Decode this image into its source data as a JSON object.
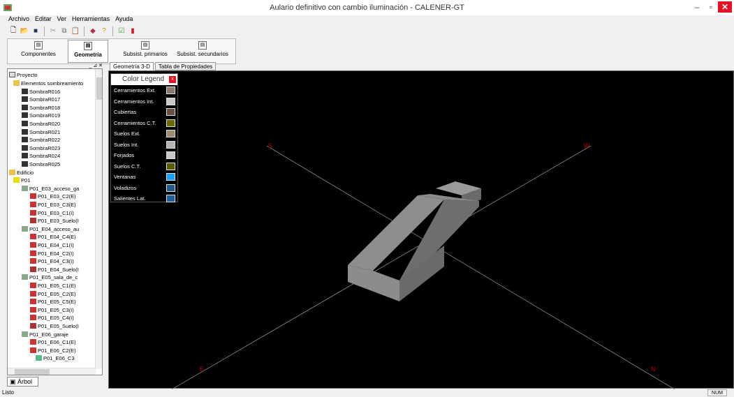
{
  "window": {
    "title": "Aulario definitivo con cambio iluminación - CALENER-GT"
  },
  "menu": [
    "Archivo",
    "Editar",
    "Ver",
    "Herramientas",
    "Ayuda"
  ],
  "ribbon_tabs": [
    {
      "label": "Componentes"
    },
    {
      "label": "Geometría"
    },
    {
      "label": "Subsist. primarios"
    },
    {
      "label": "Subsist. secundarios"
    }
  ],
  "tree": {
    "root": "Proyecto",
    "items": [
      "Elementos sombreamiento",
      "SombraR016",
      "SombraR017",
      "SombraR018",
      "SombraR019",
      "SombraR020",
      "SombraR021",
      "SombraR022",
      "SombraR023",
      "SombraR024",
      "SombraR025",
      "Edificio",
      "P01",
      "P01_E03_acceso_ga",
      "P01_E03_C2(E)",
      "P01_E03_C3(E)",
      "P01_E03_C1(I)",
      "P01_E03_Suelo(I",
      "P01_E04_acceso_au",
      "P01_E04_C4(E)",
      "P01_E04_C1(I)",
      "P01_E04_C2(I)",
      "P01_E04_C3(I)",
      "P01_E04_Suelo(I",
      "P01_E05_sala_de_c",
      "P01_E05_C1(E)",
      "P01_E05_C2(E)",
      "P01_E05_C5(E)",
      "P01_E05_C3(I)",
      "P01_E05_C4(I)",
      "P01_E05_Suelo(I",
      "P01_E06_garaje",
      "P01_E06_C1(E)",
      "P01_E06_C2(E)",
      "P01_E06_C3"
    ]
  },
  "bottom_tab": "Árbol",
  "view_tabs": [
    "Geometría 3-D",
    "Tabla de Propiedades"
  ],
  "legend": {
    "title": "Color Legend",
    "entries": [
      {
        "label": "Cerramientos Ext.",
        "color": "#8c7a6b"
      },
      {
        "label": "Cerramientos Int.",
        "color": "#c8c8c8"
      },
      {
        "label": "Cubiertas",
        "color": "#6b5040"
      },
      {
        "label": "Cerramientos C.T.",
        "color": "#6b6b00"
      },
      {
        "label": "Suelos Ext.",
        "color": "#a08a70"
      },
      {
        "label": "Suelos Int.",
        "color": "#b4b4b4"
      },
      {
        "label": "Forjados",
        "color": "#c8c8c8"
      },
      {
        "label": "Suelos C.T.",
        "color": "#5a5a00"
      },
      {
        "label": "Ventanas",
        "color": "#1e9eff"
      },
      {
        "label": "Voladizos",
        "color": "#1e5a8c"
      },
      {
        "label": "Salientes Lat.",
        "color": "#2060a0"
      }
    ]
  },
  "compass": {
    "s": "S",
    "w": "W",
    "e": "E",
    "n": "N"
  },
  "status": {
    "text": "Listo",
    "num": "NUM"
  }
}
